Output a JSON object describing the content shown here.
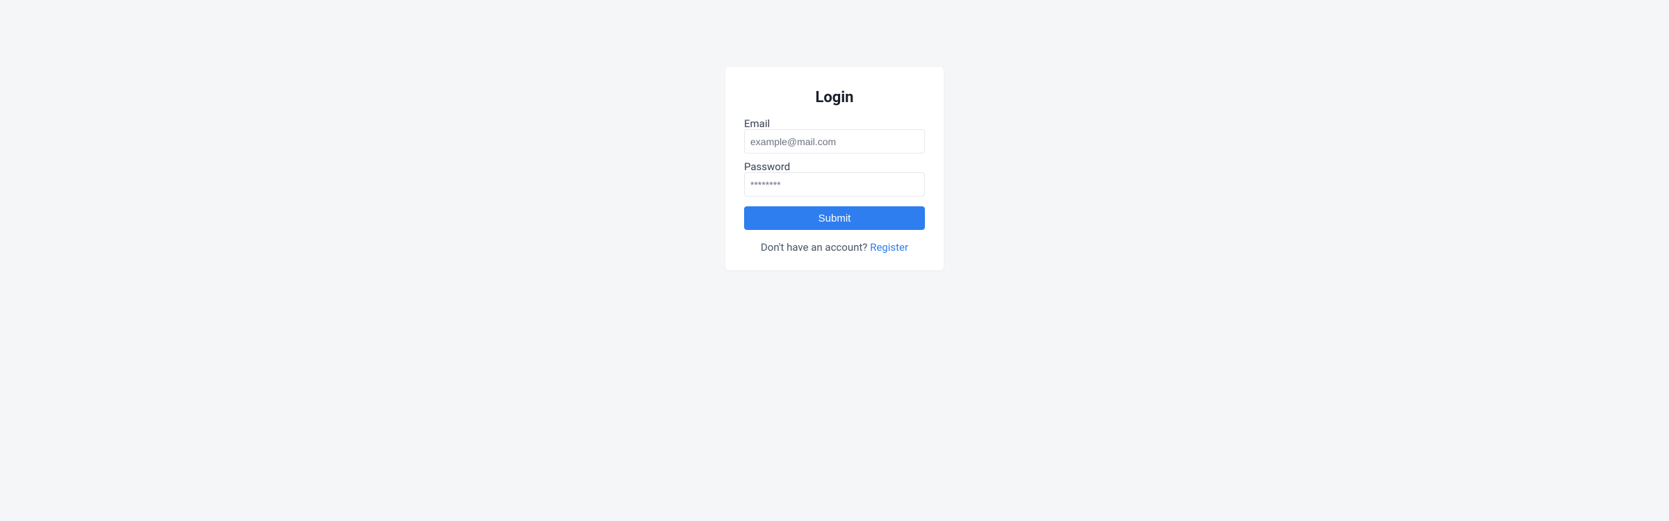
{
  "card": {
    "title": "Login"
  },
  "form": {
    "email": {
      "label": "Email",
      "placeholder": "example@mail.com",
      "value": ""
    },
    "password": {
      "label": "Password",
      "placeholder": "********",
      "value": ""
    },
    "submit_label": "Submit"
  },
  "footer": {
    "text": "Don't have an account? ",
    "link_text": "Register"
  }
}
